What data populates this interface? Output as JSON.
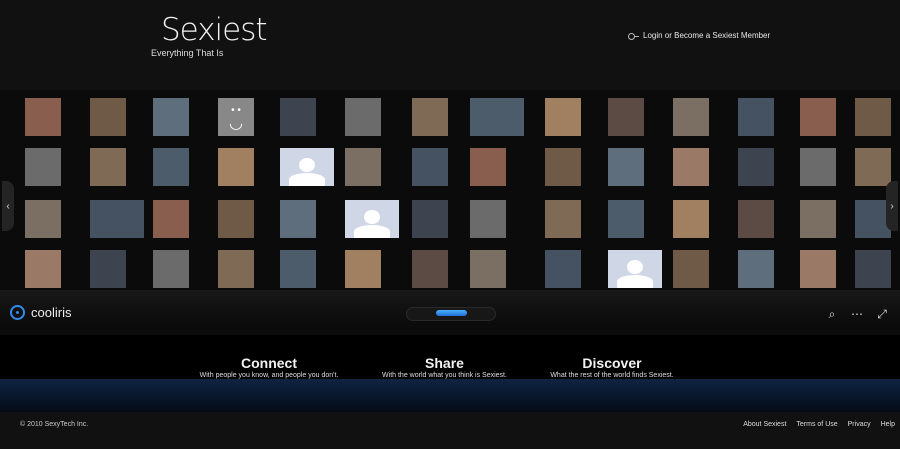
{
  "brand": {
    "logo": "Sexiest",
    "tagline": "Everything That Is",
    "login_text": "Login or Become a Sexiest Member"
  },
  "wall": {
    "plugin_name": "cooliris",
    "rows": [
      [
        "photo",
        "photo",
        "photo",
        "smiley",
        "photo",
        "photo",
        "photo",
        "photo",
        "photo",
        "photo",
        "photo",
        "photo",
        "photo",
        "photo"
      ],
      [
        "photo",
        "photo",
        "photo",
        "photo",
        "silhouette",
        "photo",
        "photo",
        "photo",
        "photo",
        "photo",
        "photo",
        "photo",
        "photo",
        "photo"
      ],
      [
        "photo",
        "photo",
        "photo",
        "photo",
        "photo",
        "silhouette",
        "photo",
        "photo",
        "photo",
        "photo",
        "photo",
        "photo",
        "photo",
        "photo"
      ],
      [
        "photo",
        "photo",
        "photo",
        "photo",
        "photo",
        "photo",
        "photo",
        "photo",
        "photo",
        "silhouette",
        "photo",
        "photo",
        "photo",
        "photo"
      ]
    ]
  },
  "features": [
    {
      "title": "Connect",
      "subtitle": "With people you know, and people you don't."
    },
    {
      "title": "Share",
      "subtitle": "With the world what you think is Sexiest."
    },
    {
      "title": "Discover",
      "subtitle": "What the rest of the world finds Sexiest."
    }
  ],
  "footer": {
    "copyright": "© 2010 SexyTech Inc.",
    "links": [
      "About Sexiest",
      "Terms of Use",
      "Privacy",
      "Help"
    ]
  },
  "icons": [
    "key-icon",
    "left-arrow-icon",
    "right-arrow-icon",
    "cooliris-icon",
    "search-icon",
    "share-icon",
    "fullscreen-icon"
  ],
  "colors": {
    "accent": "#2f8de8",
    "background": "#000000",
    "band": "#0f2442"
  }
}
